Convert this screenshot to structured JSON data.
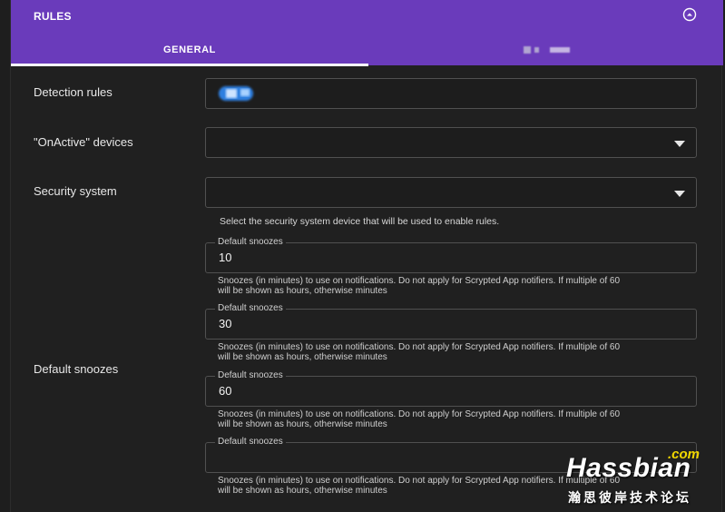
{
  "header": {
    "title": "RULES",
    "collapse_icon": "chevron-up-icon"
  },
  "tabs": [
    {
      "label": "GENERAL",
      "active": true
    },
    {
      "label": "",
      "active": false
    }
  ],
  "form": {
    "detection_rules": {
      "label": "Detection rules"
    },
    "onactive_devices": {
      "label": "\"OnActive\" devices",
      "value": ""
    },
    "security_system": {
      "label": "Security system",
      "value": "",
      "helper": "Select the security system device that will be used to enable rules."
    },
    "default_snoozes": {
      "label": "Default snoozes",
      "fields": [
        {
          "legend": "Default snoozes",
          "value": "10",
          "helper_line1": "Snoozes (in minutes) to use on notifications. Do not apply for Scrypted App notifiers. If multiple of 60",
          "helper_line2": "will be shown as hours, otherwise minutes"
        },
        {
          "legend": "Default snoozes",
          "value": "30",
          "helper_line1": "Snoozes (in minutes) to use on notifications. Do not apply for Scrypted App notifiers. If multiple of 60",
          "helper_line2": "will be shown as hours, otherwise minutes"
        },
        {
          "legend": "Default snoozes",
          "value": "60",
          "helper_line1": "Snoozes (in minutes) to use on notifications. Do not apply for Scrypted App notifiers. If multiple of 60",
          "helper_line2": "will be shown as hours, otherwise minutes"
        },
        {
          "legend": "Default snoozes",
          "value": "",
          "helper_line1": "Snoozes (in minutes) to use on notifications. Do not apply for Scrypted App notifiers. If multiple of 60",
          "helper_line2": "will be shown as hours, otherwise minutes"
        }
      ]
    }
  },
  "watermark": {
    "com": ".com",
    "main": "Hassbian",
    "sub": "瀚思彼岸技术论坛"
  },
  "colors": {
    "accent": "#6a3bbb",
    "background": "#202020",
    "border": "#505050"
  }
}
